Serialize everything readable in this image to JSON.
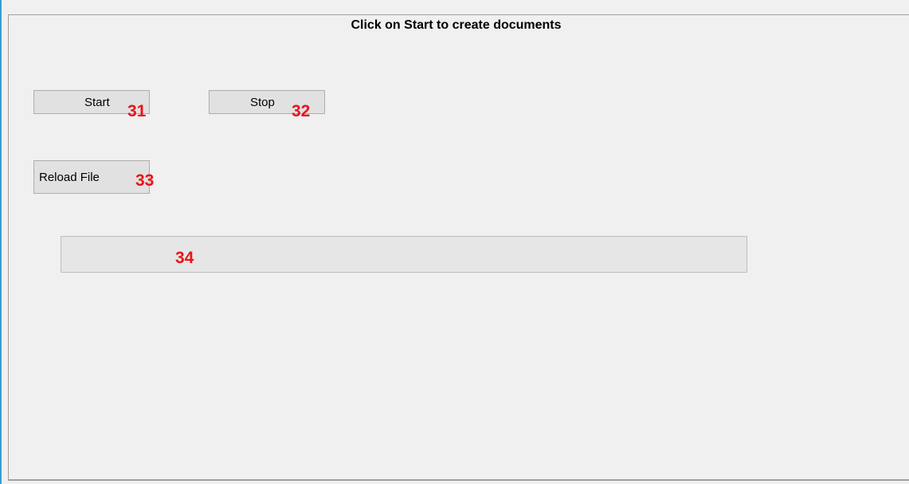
{
  "group": {
    "title": "Click on Start to create documents"
  },
  "buttons": {
    "start": {
      "label": "Start",
      "marker": "31"
    },
    "stop": {
      "label": "Stop",
      "marker": "32"
    },
    "reload": {
      "label": "Reload File",
      "marker": "33"
    }
  },
  "progress": {
    "value": 0,
    "marker": "34"
  },
  "colors": {
    "marker": "#e8141b",
    "window_border": "#3c9ad6"
  }
}
